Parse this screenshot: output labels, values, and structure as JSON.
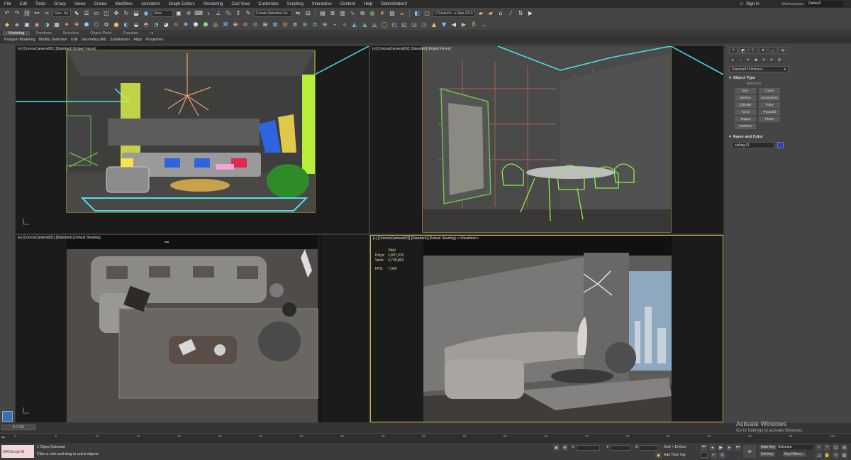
{
  "menu": [
    "File",
    "Edit",
    "Tools",
    "Group",
    "Views",
    "Create",
    "Modifiers",
    "Animation",
    "Graph Editors",
    "Rendering",
    "Civil View",
    "Customize",
    "Scripting",
    "Interactive",
    "Content",
    "Help",
    "DebrisMaker2"
  ],
  "signin": "Sign In",
  "workspaces_label": "Workspaces:",
  "workspaces_value": "Default",
  "toolbar": {
    "selection_filter": "Geo...try",
    "view_dropdown": "View",
    "named_selection": "Create Selection Se",
    "project_path": "C:\\Users\\h...s Max 2019"
  },
  "ribbon_tabs": [
    "Modeling",
    "Freeform",
    "Selection",
    "Object Paint",
    "Populate"
  ],
  "ribbon_sub": [
    "Polygon Modeling",
    "Modify Selection",
    "Edit",
    "Geometry (All)",
    "Subdivision",
    "Align",
    "Properties"
  ],
  "viewports": [
    {
      "label": "[+] [CoronaCamera001] [Standard] [Edged Faces]"
    },
    {
      "label": "[+] [CoronaCamera002] [Standard] [Edged Faces]"
    },
    {
      "label": "[+] [CoronaCamera001] [Standard] [Default Shading]"
    },
    {
      "label": "[+] [CoronaCamera003] [Standard] [Default Shading] <<Disabled>>"
    }
  ],
  "stats": {
    "total": "Total",
    "polys_label": "Polys:",
    "polys": "1,897,076",
    "verts_label": "Verts:",
    "verts": "3,735,802",
    "fps_label": "FPS:",
    "fps": "7.042"
  },
  "cmd_panel": {
    "dropdown": "Standard Primitives",
    "object_type": "Object Type",
    "autogrid": "AutoGrid",
    "buttons": [
      "Box",
      "Cone",
      "Sphere",
      "GeoSphere",
      "Cylinder",
      "Tube",
      "Torus",
      "Pyramid",
      "Teapot",
      "Plane",
      "TextPlus"
    ],
    "name_color": "Name and Color",
    "object_name": "ceiling 01"
  },
  "timeline": {
    "frame": "0 / 100",
    "ticks": [
      "0",
      "5",
      "10",
      "15",
      "20",
      "25",
      "30",
      "35",
      "40",
      "45",
      "50",
      "55",
      "60",
      "65",
      "70",
      "75",
      "80",
      "85",
      "90",
      "95",
      "100"
    ]
  },
  "status": {
    "maxscript": "MAXScript Mi",
    "selected": "1 Object Selected",
    "prompt": "Click or click-and-drag to select objects",
    "x": "X:",
    "y": "Y:",
    "z": "Z:",
    "grid": "Grid = 10.0cm",
    "add_time_tag": "Add Time Tag",
    "auto_key": "Auto Key",
    "selected_dropdown": "Selected",
    "set_key": "Set Key",
    "key_filters": "Key Filters..."
  },
  "watermark": {
    "title": "Activate Windows",
    "subtitle": "Go to Settings to activate Windows."
  }
}
